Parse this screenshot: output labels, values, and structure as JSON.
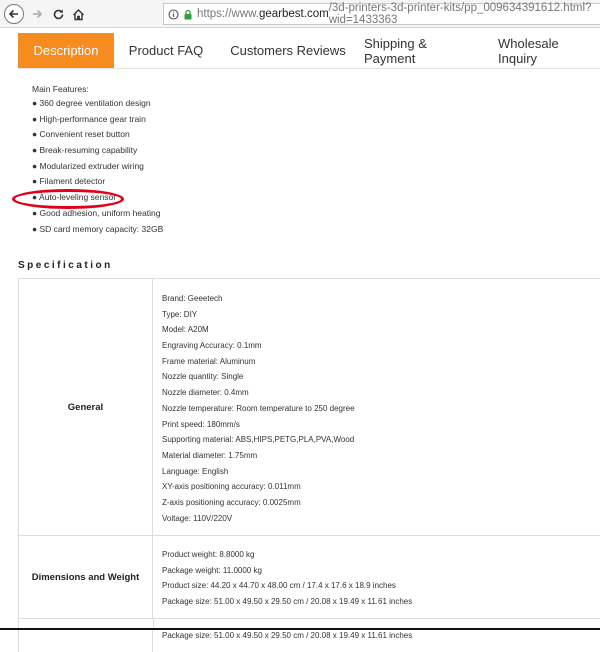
{
  "browser": {
    "url_scheme": "https://www.",
    "url_host": "gearbest.com",
    "url_path": "/3d-printers-3d-printer-kits/pp_009634391612.html?wid=1433363",
    "icons": [
      "back-arrow-icon",
      "forward-arrow-icon",
      "reload-icon",
      "home-icon",
      "secure-info-icon",
      "lock-icon"
    ]
  },
  "tabs": [
    {
      "label": "Description",
      "active": true
    },
    {
      "label": "Product FAQ",
      "active": false
    },
    {
      "label": "Customers Reviews",
      "active": false
    },
    {
      "label": "Shipping & Payment",
      "active": false
    },
    {
      "label": "Wholesale Inquiry",
      "active": false
    }
  ],
  "colors": {
    "accent": "#f68b1f",
    "highlight": "#e3001b",
    "secure": "#2e9e3e"
  },
  "features": {
    "title": "Main Features:",
    "items": [
      "● 360 degree ventilation design",
      "● High-performance gear train",
      "● Convenient reset button",
      "● Break-resuming capability",
      "● Modularized extruder wiring",
      "● Filament detector",
      "● Auto-leveling sensor",
      "● Good adhesion, uniform heating",
      "● SD card memory capacity: 32GB"
    ]
  },
  "specification": {
    "heading": "Specification",
    "groups": [
      {
        "label": "General",
        "values": [
          "Brand: Geeetech",
          "Type: DIY",
          "Model: A20M",
          "Engraving Accuracy: 0.1mm",
          "Frame material: Aluminum",
          "Nozzle quantity: Single",
          "Nozzle diameter: 0.4mm",
          "Nozzle temperature: Room temperature to 250 degree",
          "Print speed: 180mm/s",
          "Supporting material: ABS,HIPS,PETG,PLA,PVA,Wood",
          "Material diameter: 1.75mm",
          "Language: English",
          "XY-axis positioning accuracy: 0.011mm",
          "Z-axis positioning accuracy: 0.0025mm",
          "Voltage: 110V/220V"
        ]
      },
      {
        "label": "Dimensions and Weight",
        "values": [
          "Product weight: 8.8000 kg",
          "Package weight: 11.0000 kg",
          "Product size: 44.20 x 44.70 x 48.00 cm / 17.4 x 17.6 x 18.9 inches",
          "Package size: 51.00 x 49.50 x 29.50 cm / 20.08 x 19.49 x 11.61 inches"
        ]
      }
    ],
    "repeat_line": "Package size: 51.00 x 49.50 x 29.50 cm / 20.08 x 19.49 x 11.61 inches"
  }
}
